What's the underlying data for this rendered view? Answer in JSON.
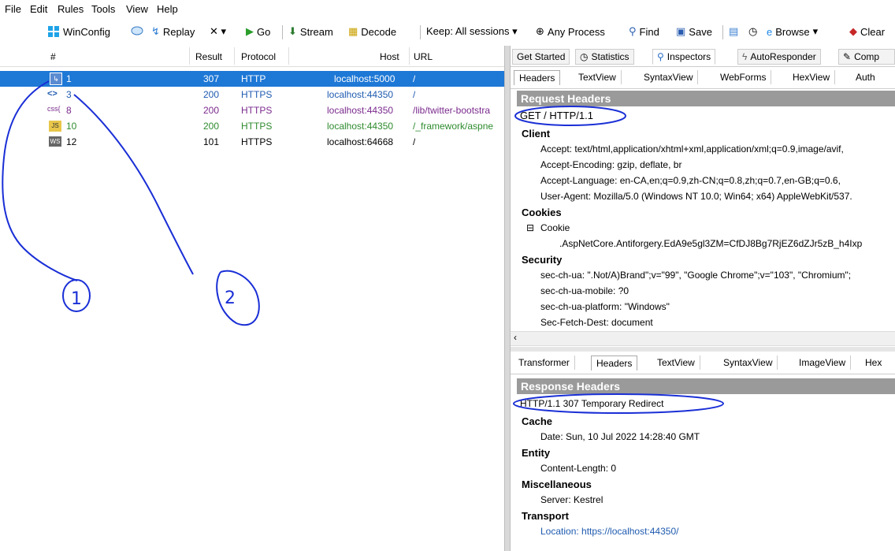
{
  "menu": [
    "File",
    "Edit",
    "Rules",
    "Tools",
    "View",
    "Help"
  ],
  "toolbar": {
    "winconfig": "WinConfig",
    "replay": "Replay",
    "x": "✕ ▾",
    "go": "Go",
    "stream": "Stream",
    "decode": "Decode",
    "keep": "Keep: All sessions ▾",
    "anyprocess": "Any Process",
    "find": "Find",
    "save": "Save",
    "browse": "Browse",
    "clear": "Clear"
  },
  "sessions": {
    "headers": {
      "num": "#",
      "result": "Result",
      "protocol": "Protocol",
      "host": "Host",
      "url": "URL"
    },
    "rows": [
      {
        "num": "1",
        "result": "307",
        "protocol": "HTTP",
        "host": "localhost:5000",
        "url": "/"
      },
      {
        "num": "3",
        "result": "200",
        "protocol": "HTTPS",
        "host": "localhost:44350",
        "url": "/"
      },
      {
        "num": "8",
        "result": "200",
        "protocol": "HTTPS",
        "host": "localhost:44350",
        "url": "/lib/twitter-bootstra"
      },
      {
        "num": "10",
        "result": "200",
        "protocol": "HTTPS",
        "host": "localhost:44350",
        "url": "/_framework/aspne"
      },
      {
        "num": "12",
        "result": "101",
        "protocol": "HTTPS",
        "host": "localhost:64668",
        "url": "/"
      }
    ]
  },
  "tabs": [
    "Get Started",
    "Statistics",
    "Inspectors",
    "AutoResponder",
    "Comp"
  ],
  "request_tabs": [
    "Headers",
    "TextView",
    "SyntaxView",
    "WebForms",
    "HexView",
    "Auth"
  ],
  "request": {
    "title": "Request Headers",
    "first_line": "GET / HTTP/1.1",
    "client_label": "Client",
    "client": [
      "Accept: text/html,application/xhtml+xml,application/xml;q=0.9,image/avif,",
      "Accept-Encoding: gzip, deflate, br",
      "Accept-Language: en-CA,en;q=0.9,zh-CN;q=0.8,zh;q=0.7,en-GB;q=0.6,",
      "User-Agent: Mozilla/5.0 (Windows NT 10.0; Win64; x64) AppleWebKit/537."
    ],
    "cookies_label": "Cookies",
    "cookie_name": "Cookie",
    "cookie_value": ".AspNetCore.Antiforgery.EdA9e5gl3ZM=CfDJ8Bg7RjEZ6dZJr5zB_h4Ixp",
    "security_label": "Security",
    "security": [
      "sec-ch-ua: \".Not/A)Brand\";v=\"99\", \"Google Chrome\";v=\"103\", \"Chromium\";",
      "sec-ch-ua-mobile: ?0",
      "sec-ch-ua-platform: \"Windows\"",
      "Sec-Fetch-Dest: document"
    ]
  },
  "response_tabs": [
    "Transformer",
    "Headers",
    "TextView",
    "SyntaxView",
    "ImageView",
    "Hex"
  ],
  "response": {
    "title": "Response Headers",
    "first_line": "HTTP/1.1 307 Temporary Redirect",
    "cache_label": "Cache",
    "date": "Date: Sun, 10 Jul 2022 14:28:40 GMT",
    "entity_label": "Entity",
    "content_length": "Content-Length: 0",
    "misc_label": "Miscellaneous",
    "server": "Server: Kestrel",
    "transport_label": "Transport",
    "location": "Location: https://localhost:44350/"
  },
  "annotations": {
    "one": "1",
    "two": "2"
  },
  "colors": {
    "selected": "#1e78d6",
    "https_blue": "#1f5bb0",
    "css_purple": "#7a2a8c",
    "js_green": "#2e8b2e",
    "annotation": "#1a2fd6"
  }
}
